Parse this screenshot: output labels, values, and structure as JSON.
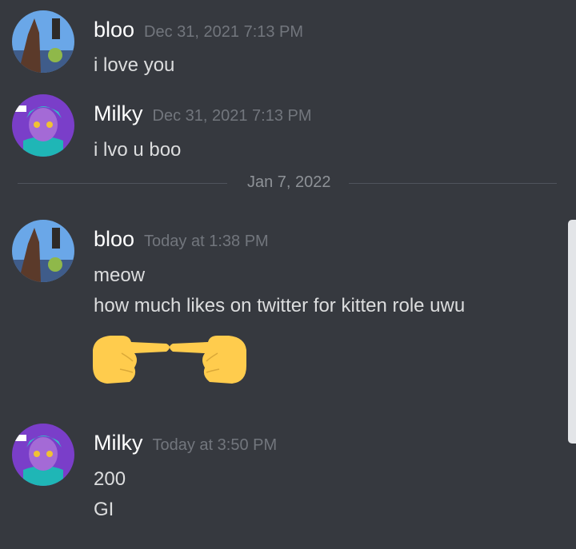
{
  "messages": [
    {
      "username": "bloo",
      "timestamp": "Dec 31, 2021 7:13 PM",
      "lines": [
        "i love you"
      ]
    },
    {
      "username": "Milky",
      "timestamp": "Dec 31, 2021 7:13 PM",
      "lines": [
        "i lvo u boo"
      ]
    },
    {
      "username": "bloo",
      "timestamp": "Today at 1:38 PM",
      "lines": [
        "meow",
        "how much likes on twitter for kitten role uwu"
      ],
      "emoji": "pointing-fingers-together"
    },
    {
      "username": "Milky",
      "timestamp": "Today at 3:50 PM",
      "lines": [
        "200",
        "GI"
      ]
    }
  ],
  "divider": {
    "date": "Jan 7, 2022"
  },
  "colors": {
    "background": "#36393f",
    "username": "#ffffff",
    "timestamp": "#72767d",
    "text": "#dcddde",
    "divider": "#4f545c"
  }
}
